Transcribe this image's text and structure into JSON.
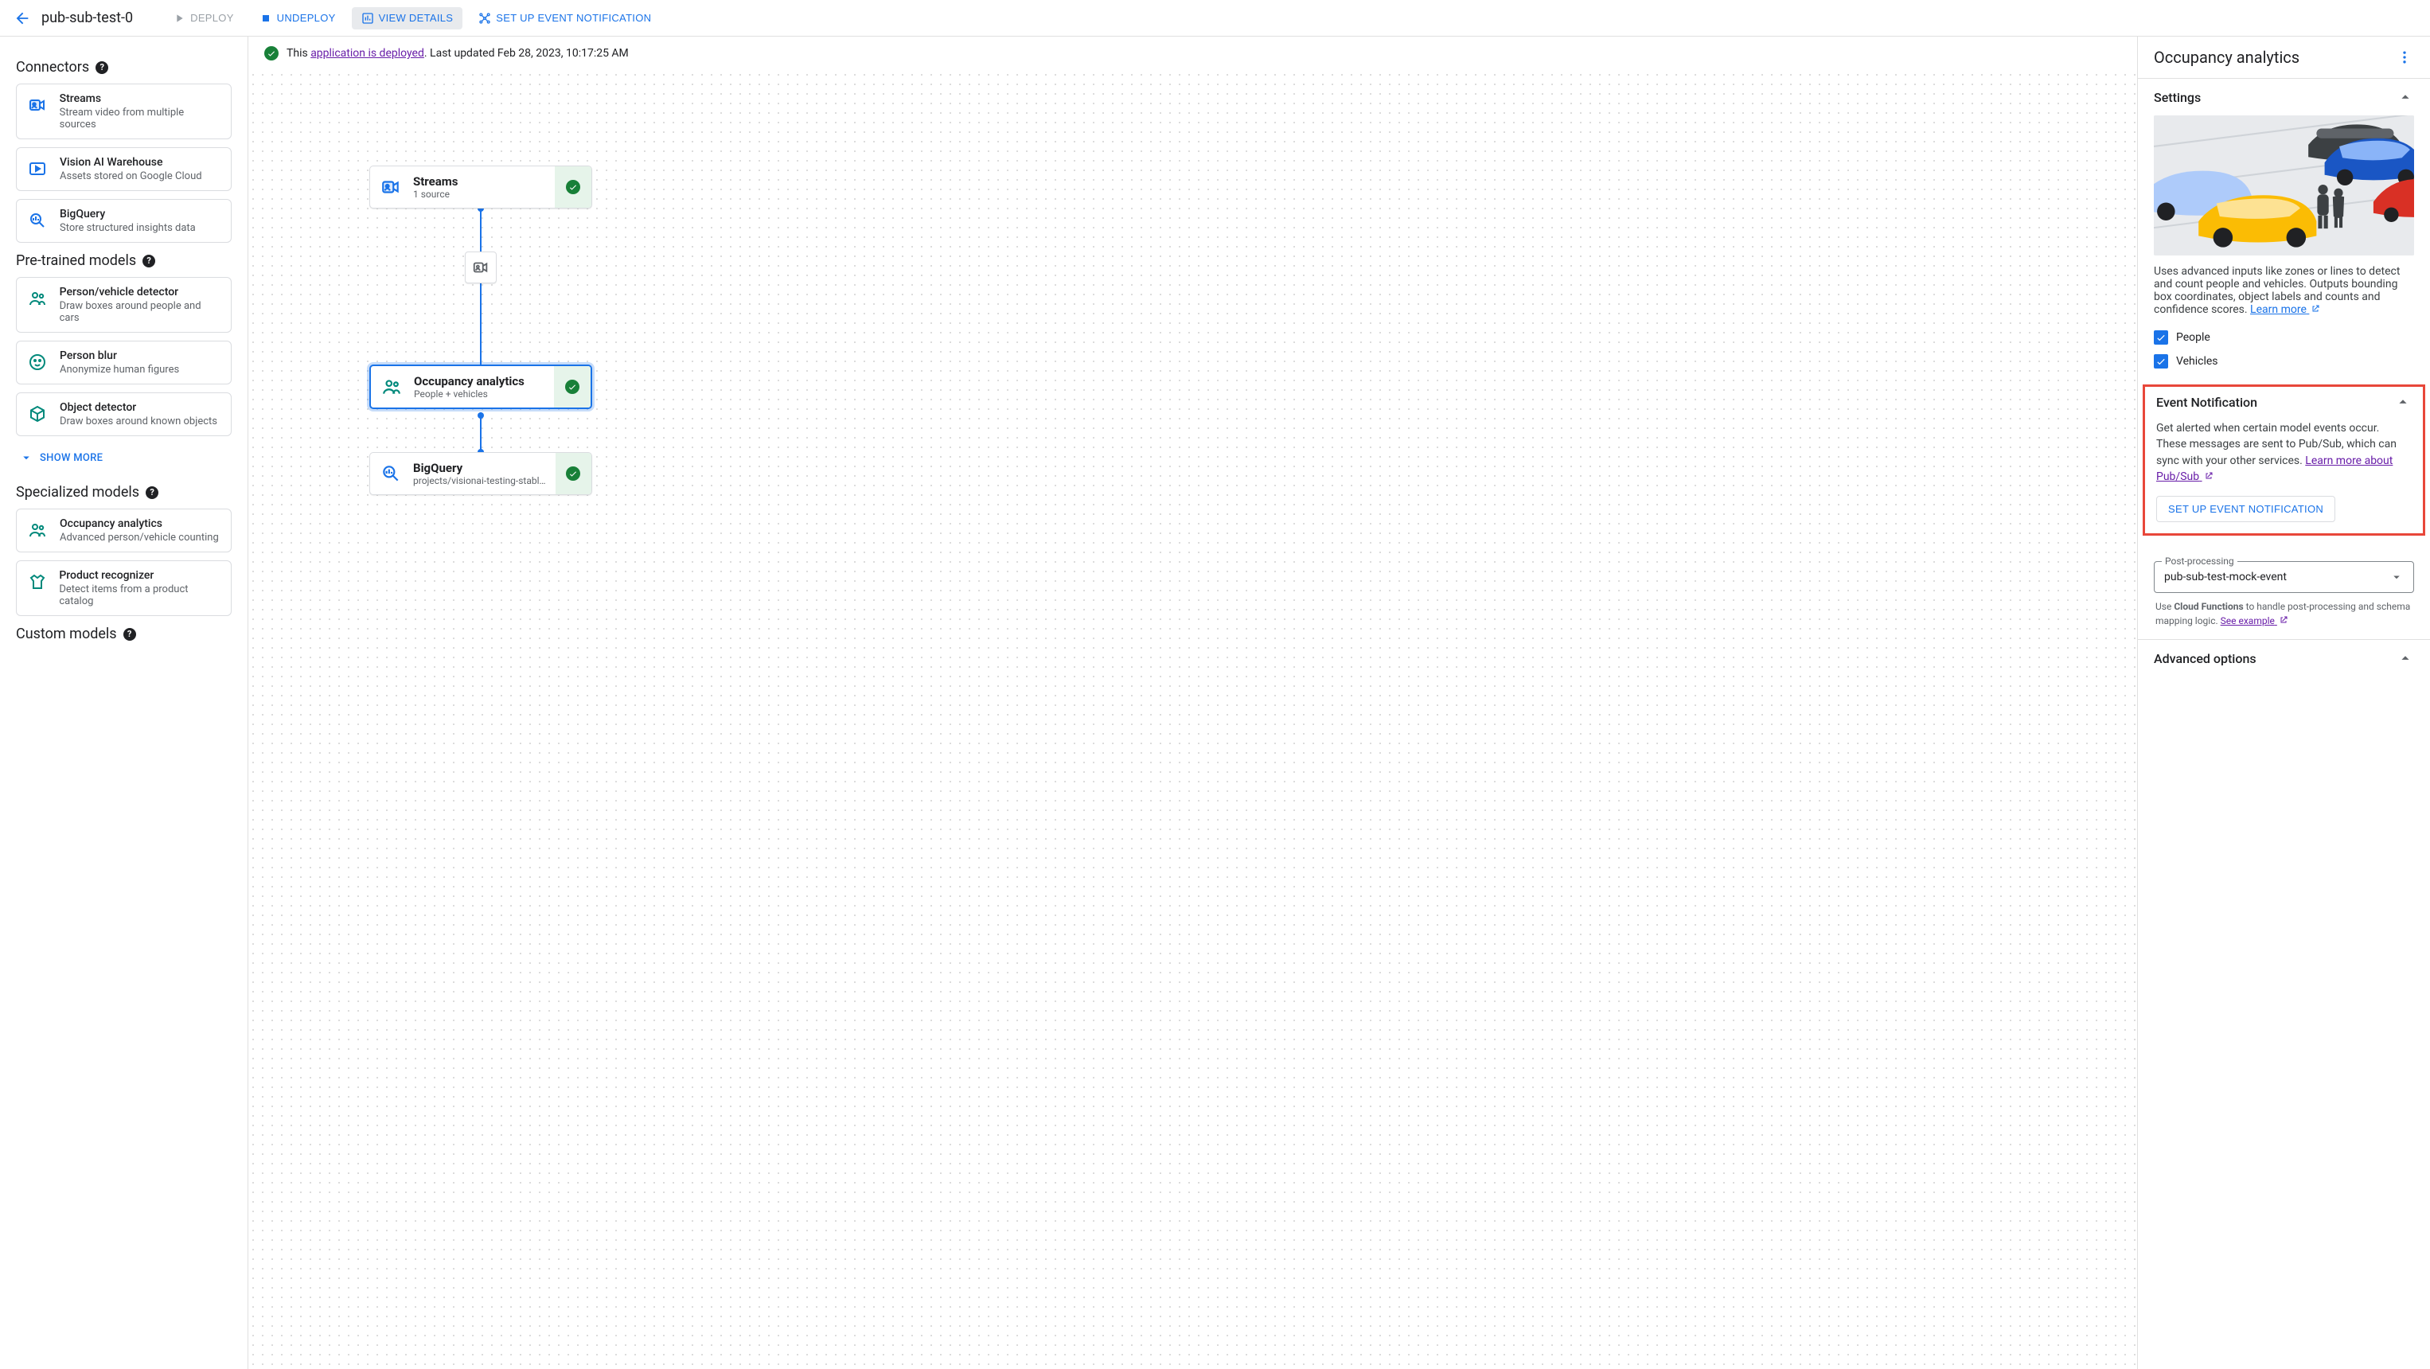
{
  "header": {
    "page_title": "pub-sub-test-0",
    "buttons": {
      "deploy": "DEPLOY",
      "undeploy": "UNDEPLOY",
      "view_details": "VIEW DETAILS",
      "setup_event": "SET UP EVENT NOTIFICATION"
    }
  },
  "status": {
    "prefix": "This",
    "link": "application is deployed",
    "suffix": ". Last updated Feb 28, 2023, 10:17:25 AM"
  },
  "sidebar": {
    "sections": {
      "connectors": {
        "title": "Connectors"
      },
      "pretrained": {
        "title": "Pre-trained models"
      },
      "specialized": {
        "title": "Specialized models"
      },
      "custom": {
        "title": "Custom models"
      }
    },
    "connectors": [
      {
        "title": "Streams",
        "sub": "Stream video from multiple sources",
        "icon": "camera-id"
      },
      {
        "title": "Vision AI Warehouse",
        "sub": "Assets stored on Google Cloud",
        "icon": "play-square"
      },
      {
        "title": "BigQuery",
        "sub": "Store structured insights data",
        "icon": "bq"
      }
    ],
    "pretrained": [
      {
        "title": "Person/vehicle detector",
        "sub": "Draw boxes around people and cars",
        "icon": "people",
        "color": "teal"
      },
      {
        "title": "Person blur",
        "sub": "Anonymize human figures",
        "icon": "face",
        "color": "teal"
      },
      {
        "title": "Object detector",
        "sub": "Draw boxes around known objects",
        "icon": "cube",
        "color": "teal"
      }
    ],
    "show_more": "SHOW MORE",
    "specialized": [
      {
        "title": "Occupancy analytics",
        "sub": "Advanced person/vehicle counting",
        "icon": "people",
        "color": "teal"
      },
      {
        "title": "Product recognizer",
        "sub": "Detect items from a product catalog",
        "icon": "shirt",
        "color": "teal"
      }
    ]
  },
  "canvas": {
    "nodes": {
      "streams": {
        "title": "Streams",
        "sub": "1 source"
      },
      "occupancy": {
        "title": "Occupancy analytics",
        "sub": "People + vehicles"
      },
      "bigquery": {
        "title": "BigQuery",
        "sub": "projects/visionai-testing-stabl…"
      }
    }
  },
  "right": {
    "title": "Occupancy analytics",
    "settings": {
      "heading": "Settings",
      "desc": "Uses advanced inputs like zones or lines to detect and count people and vehicles. Outputs bounding box coordinates, object labels and counts and confidence scores. ",
      "learn_more": "Learn more"
    },
    "checkboxes": {
      "people": "People",
      "vehicles": "Vehicles"
    },
    "event": {
      "heading": "Event Notification",
      "desc": "Get alerted when certain model events occur. These messages are sent to Pub/Sub, which can sync with your other services. ",
      "link": "Learn more about Pub/Sub",
      "button": "SET UP EVENT NOTIFICATION"
    },
    "postproc": {
      "label": "Post-processing",
      "value": "pub-sub-test-mock-event",
      "caption_prefix": "Use ",
      "caption_bold": "Cloud Functions",
      "caption_suffix": " to handle post-processing and schema mapping logic. ",
      "caption_link": "See example"
    },
    "advanced": {
      "heading": "Advanced options"
    }
  }
}
